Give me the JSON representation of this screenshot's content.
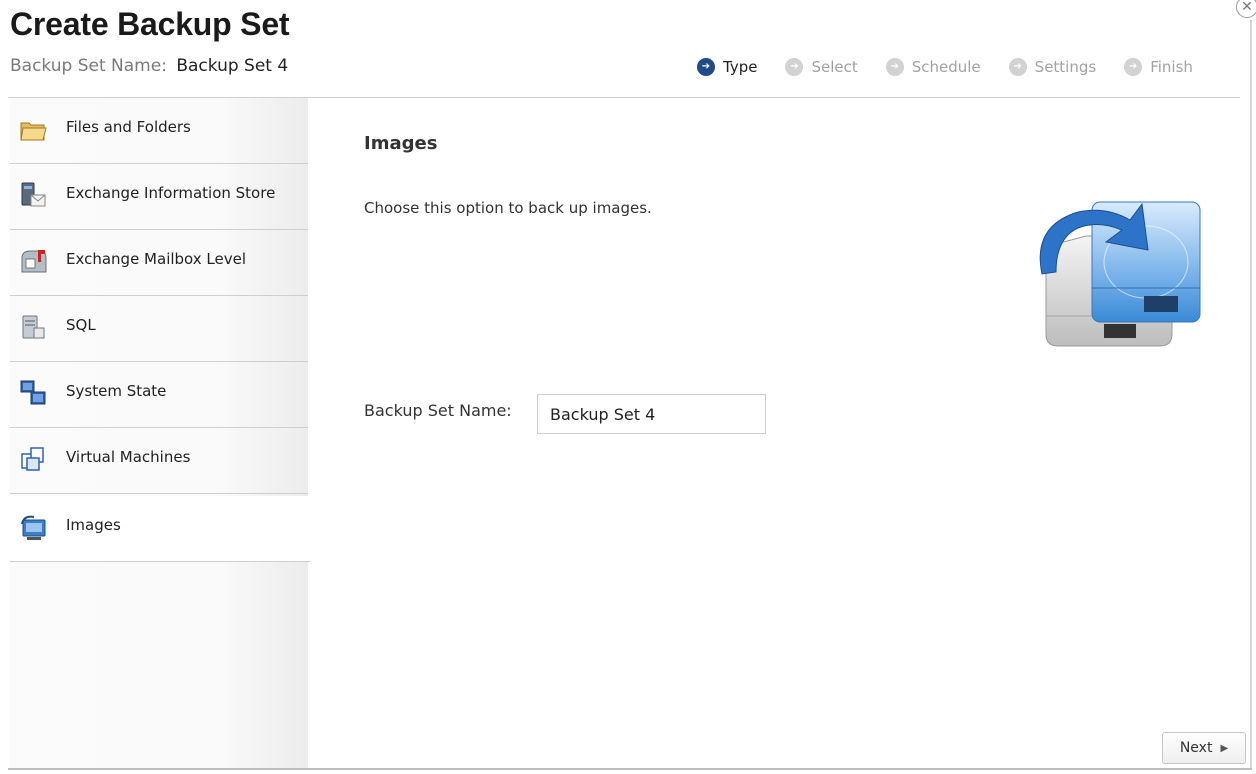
{
  "dialog": {
    "title": "Create Backup Set",
    "subtitle_label": "Backup Set Name:",
    "subtitle_value": "Backup Set 4",
    "close_glyph": "✕"
  },
  "steps": [
    {
      "label": "Type",
      "active": true
    },
    {
      "label": "Select",
      "active": false
    },
    {
      "label": "Schedule",
      "active": false
    },
    {
      "label": "Settings",
      "active": false
    },
    {
      "label": "Finish",
      "active": false
    }
  ],
  "sidebar": {
    "items": [
      {
        "label": "Files and Folders",
        "icon": "folder-icon"
      },
      {
        "label": "Exchange Information Store",
        "icon": "exchange-server-icon"
      },
      {
        "label": "Exchange Mailbox Level",
        "icon": "mailbox-icon"
      },
      {
        "label": "SQL",
        "icon": "database-icon"
      },
      {
        "label": "System State",
        "icon": "system-state-icon"
      },
      {
        "label": "Virtual Machines",
        "icon": "virtual-machines-icon"
      },
      {
        "label": "Images",
        "icon": "images-icon",
        "selected": true
      }
    ]
  },
  "content": {
    "title": "Images",
    "description": "Choose this option to back up images.",
    "hero_icon": "disk-image-backup-icon",
    "name_label": "Backup Set Name:",
    "name_value": "Backup Set 4"
  },
  "footer": {
    "next_label": "Next"
  },
  "colors": {
    "active_step": "#1f4b86",
    "inactive_step": "#d2d2d2",
    "hero_blue": "#3a8ad6"
  }
}
